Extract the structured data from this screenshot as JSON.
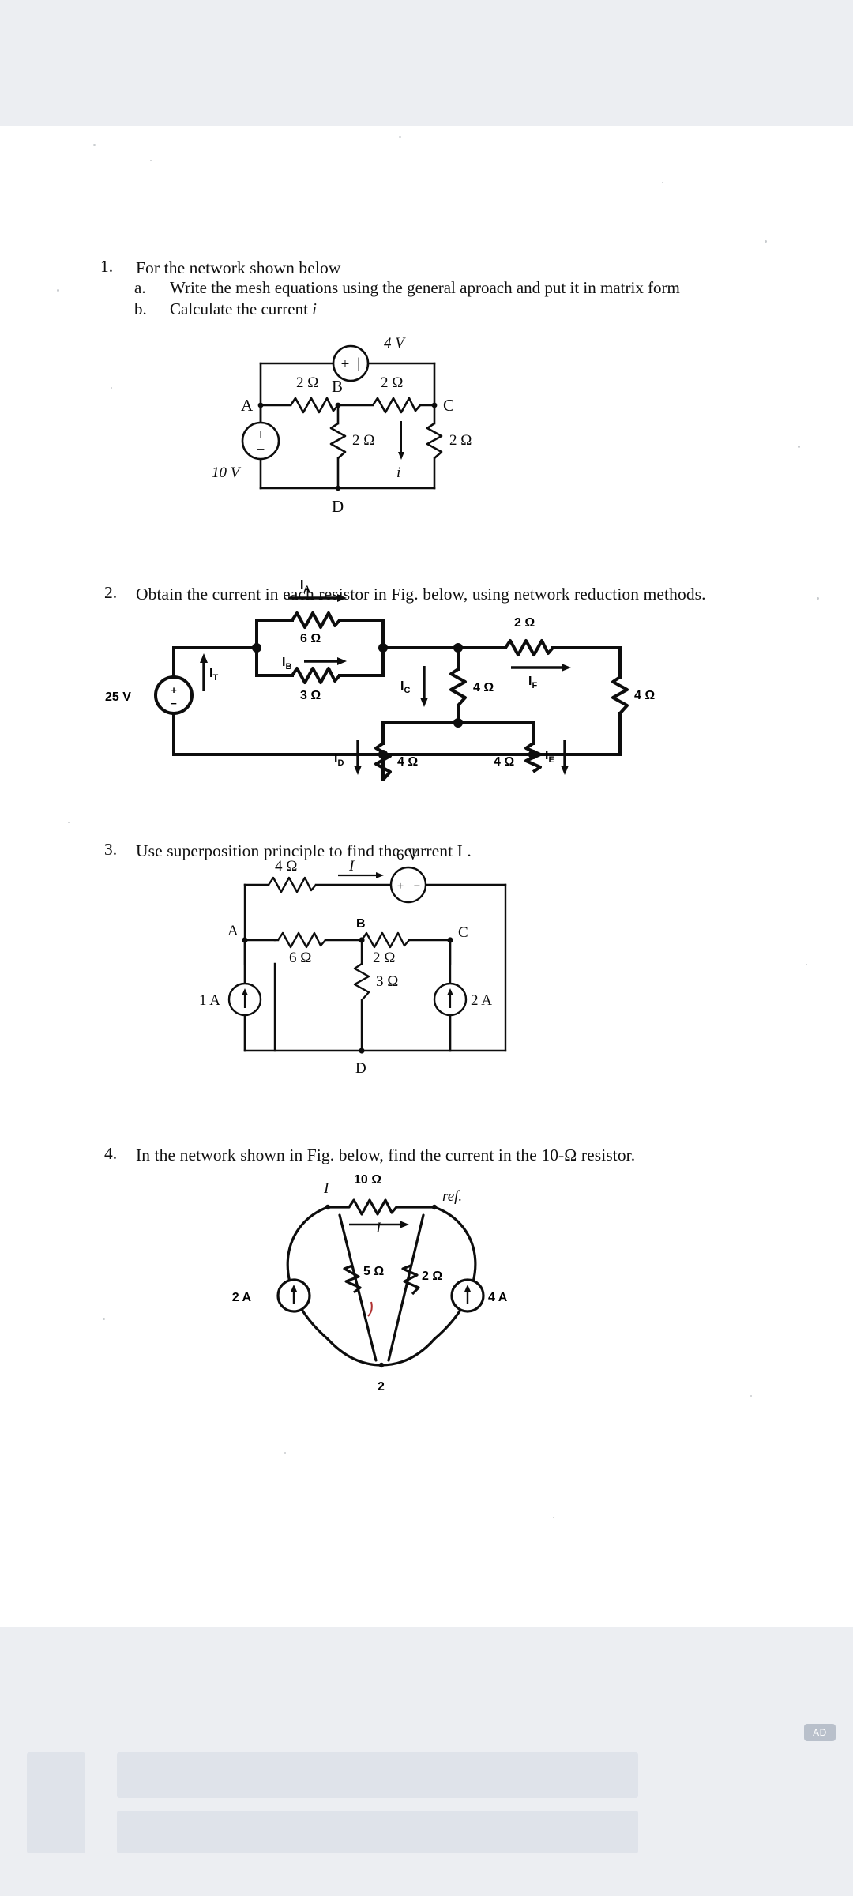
{
  "document": {
    "type": "scanned-worksheet",
    "subject": "Electrical circuit analysis problem set"
  },
  "questions": [
    {
      "number": "1.",
      "text": "For the network shown below",
      "subparts": [
        {
          "label": "a.",
          "text": "Write the mesh equations  using the general aproach and put it in matrix form"
        },
        {
          "label": "b.",
          "text": "Calculate the current i"
        }
      ]
    },
    {
      "number": "2.",
      "text": "Obtain the current in each resistor in Fig. below, using network reduction methods."
    },
    {
      "number": "3.",
      "text": "Use superposition principle to find the current I ."
    },
    {
      "number": "4.",
      "text": "In the network shown in Fig. below, find the current in the 10-Ω resistor."
    }
  ],
  "figure1": {
    "source_10v": "10 V",
    "source_4v": "4 V",
    "source_4v_polarity": "+",
    "source_10v_polarity_top": "+",
    "source_10v_polarity_bottom": "−",
    "nodes": {
      "a": "A",
      "b": "B",
      "c": "C",
      "d": "D"
    },
    "resistors": {
      "r_ab": "2 Ω",
      "r_bc": "2 Ω",
      "r_bd": "2 Ω",
      "r_cd": "2 Ω"
    },
    "current_label": "i"
  },
  "figure2": {
    "source": "25 V",
    "source_polarity_top": "+",
    "source_polarity_bottom": "−",
    "resistors": {
      "r_top": "6 Ω",
      "r_bottom": "3 Ω",
      "r_series": "2 Ω",
      "r_mid": "4 Ω",
      "r_left_branch": "4 Ω",
      "r_right_branch": "4 Ω",
      "r_right_end": "4 Ω"
    },
    "currents": {
      "ia": "I",
      "ia_sub": "A",
      "ib": "I",
      "ib_sub": "B",
      "it": "I",
      "it_sub": "T",
      "ic": "I",
      "ic_sub": "C",
      "id": "I",
      "id_sub": "D",
      "ie": "I",
      "ie_sub": "E",
      "if": "I",
      "if_sub": "F"
    }
  },
  "figure3": {
    "nodes": {
      "a": "A",
      "b": "B",
      "c": "C",
      "d": "D"
    },
    "resistors": {
      "r_top": "4 Ω",
      "r_ab": "6 Ω",
      "r_bc": "2 Ω",
      "r_bd": "3 Ω"
    },
    "sources": {
      "left_current": "1 A",
      "right_current": "2 A",
      "voltage": "6 V",
      "voltage_polarity_left": "+",
      "voltage_polarity_right": "−"
    },
    "current_label": "I"
  },
  "figure4": {
    "resistors": {
      "r_top": "10 Ω",
      "r_left": "5 Ω",
      "r_right": "2 Ω"
    },
    "sources": {
      "left_current": "2 A",
      "right_current": "4 A"
    },
    "labels": {
      "current_top_left": "I",
      "current_center": "I",
      "reference": "ref.",
      "node_bottom": "2"
    }
  },
  "ad": {
    "badge": "AD"
  }
}
